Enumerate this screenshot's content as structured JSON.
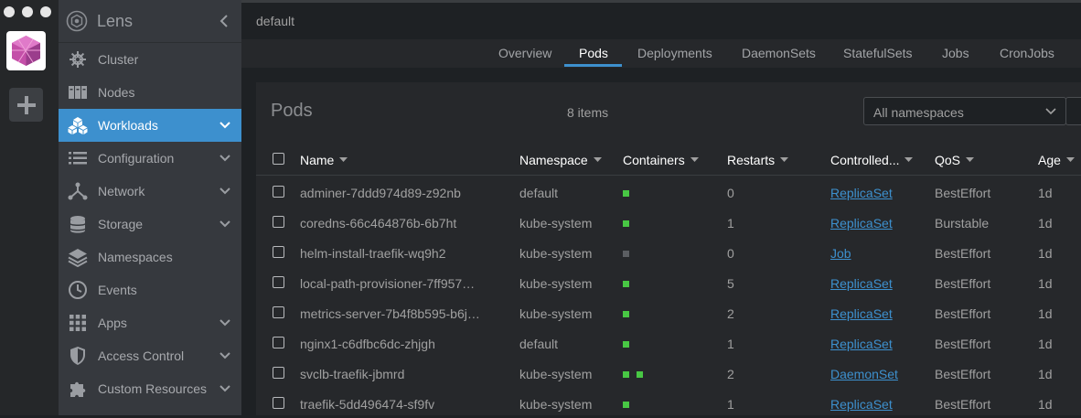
{
  "app": {
    "title": "Lens"
  },
  "breadcrumb": "default",
  "sidebar": {
    "items": [
      {
        "label": "Cluster",
        "icon": "helm-wheel-icon",
        "has_chevron": false,
        "active": false
      },
      {
        "label": "Nodes",
        "icon": "server-rack-icon",
        "has_chevron": false,
        "active": false
      },
      {
        "label": "Workloads",
        "icon": "cubes-icon",
        "has_chevron": true,
        "active": true
      },
      {
        "label": "Configuration",
        "icon": "list-icon",
        "has_chevron": true,
        "active": false
      },
      {
        "label": "Network",
        "icon": "network-icon",
        "has_chevron": true,
        "active": false
      },
      {
        "label": "Storage",
        "icon": "database-icon",
        "has_chevron": true,
        "active": false
      },
      {
        "label": "Namespaces",
        "icon": "layers-icon",
        "has_chevron": false,
        "active": false
      },
      {
        "label": "Events",
        "icon": "clock-icon",
        "has_chevron": false,
        "active": false
      },
      {
        "label": "Apps",
        "icon": "grid-icon",
        "has_chevron": true,
        "active": false
      },
      {
        "label": "Access Control",
        "icon": "shield-icon",
        "has_chevron": true,
        "active": false
      },
      {
        "label": "Custom Resources",
        "icon": "puzzle-icon",
        "has_chevron": true,
        "active": false
      }
    ]
  },
  "tabs": [
    "Overview",
    "Pods",
    "Deployments",
    "DaemonSets",
    "StatefulSets",
    "Jobs",
    "CronJobs"
  ],
  "active_tab": "Pods",
  "panel": {
    "title": "Pods",
    "items_count": "8 items",
    "namespace_select": "All namespaces"
  },
  "table": {
    "headers": [
      "Name",
      "Namespace",
      "Containers",
      "Restarts",
      "Controlled...",
      "QoS",
      "Age"
    ],
    "rows": [
      {
        "name": "adminer-7ddd974d89-z92nb",
        "namespace": "default",
        "containers": [
          "running"
        ],
        "restarts": "0",
        "controlled_by": "ReplicaSet",
        "qos": "BestEffort",
        "age": "1d"
      },
      {
        "name": "coredns-66c464876b-6b7ht",
        "namespace": "kube-system",
        "containers": [
          "running"
        ],
        "restarts": "1",
        "controlled_by": "ReplicaSet",
        "qos": "Burstable",
        "age": "1d"
      },
      {
        "name": "helm-install-traefik-wq9h2",
        "namespace": "kube-system",
        "containers": [
          "terminated"
        ],
        "restarts": "0",
        "controlled_by": "Job",
        "qos": "BestEffort",
        "age": "1d"
      },
      {
        "name": "local-path-provisioner-7ff957…",
        "namespace": "kube-system",
        "containers": [
          "running"
        ],
        "restarts": "5",
        "controlled_by": "ReplicaSet",
        "qos": "BestEffort",
        "age": "1d"
      },
      {
        "name": "metrics-server-7b4f8b595-b6j…",
        "namespace": "kube-system",
        "containers": [
          "running"
        ],
        "restarts": "2",
        "controlled_by": "ReplicaSet",
        "qos": "BestEffort",
        "age": "1d"
      },
      {
        "name": "nginx1-c6dfbc6dc-zhjgh",
        "namespace": "default",
        "containers": [
          "running"
        ],
        "restarts": "1",
        "controlled_by": "ReplicaSet",
        "qos": "BestEffort",
        "age": "1d"
      },
      {
        "name": "svclb-traefik-jbmrd",
        "namespace": "kube-system",
        "containers": [
          "running",
          "running"
        ],
        "restarts": "2",
        "controlled_by": "DaemonSet",
        "qos": "BestEffort",
        "age": "1d"
      },
      {
        "name": "traefik-5dd496474-sf9fv",
        "namespace": "kube-system",
        "containers": [
          "running"
        ],
        "restarts": "1",
        "controlled_by": "ReplicaSet",
        "qos": "BestEffort",
        "age": "1d"
      }
    ]
  },
  "colors": {
    "accent": "#3d90ce",
    "container_running": "#48c744",
    "container_terminated": "#5b5e62"
  }
}
